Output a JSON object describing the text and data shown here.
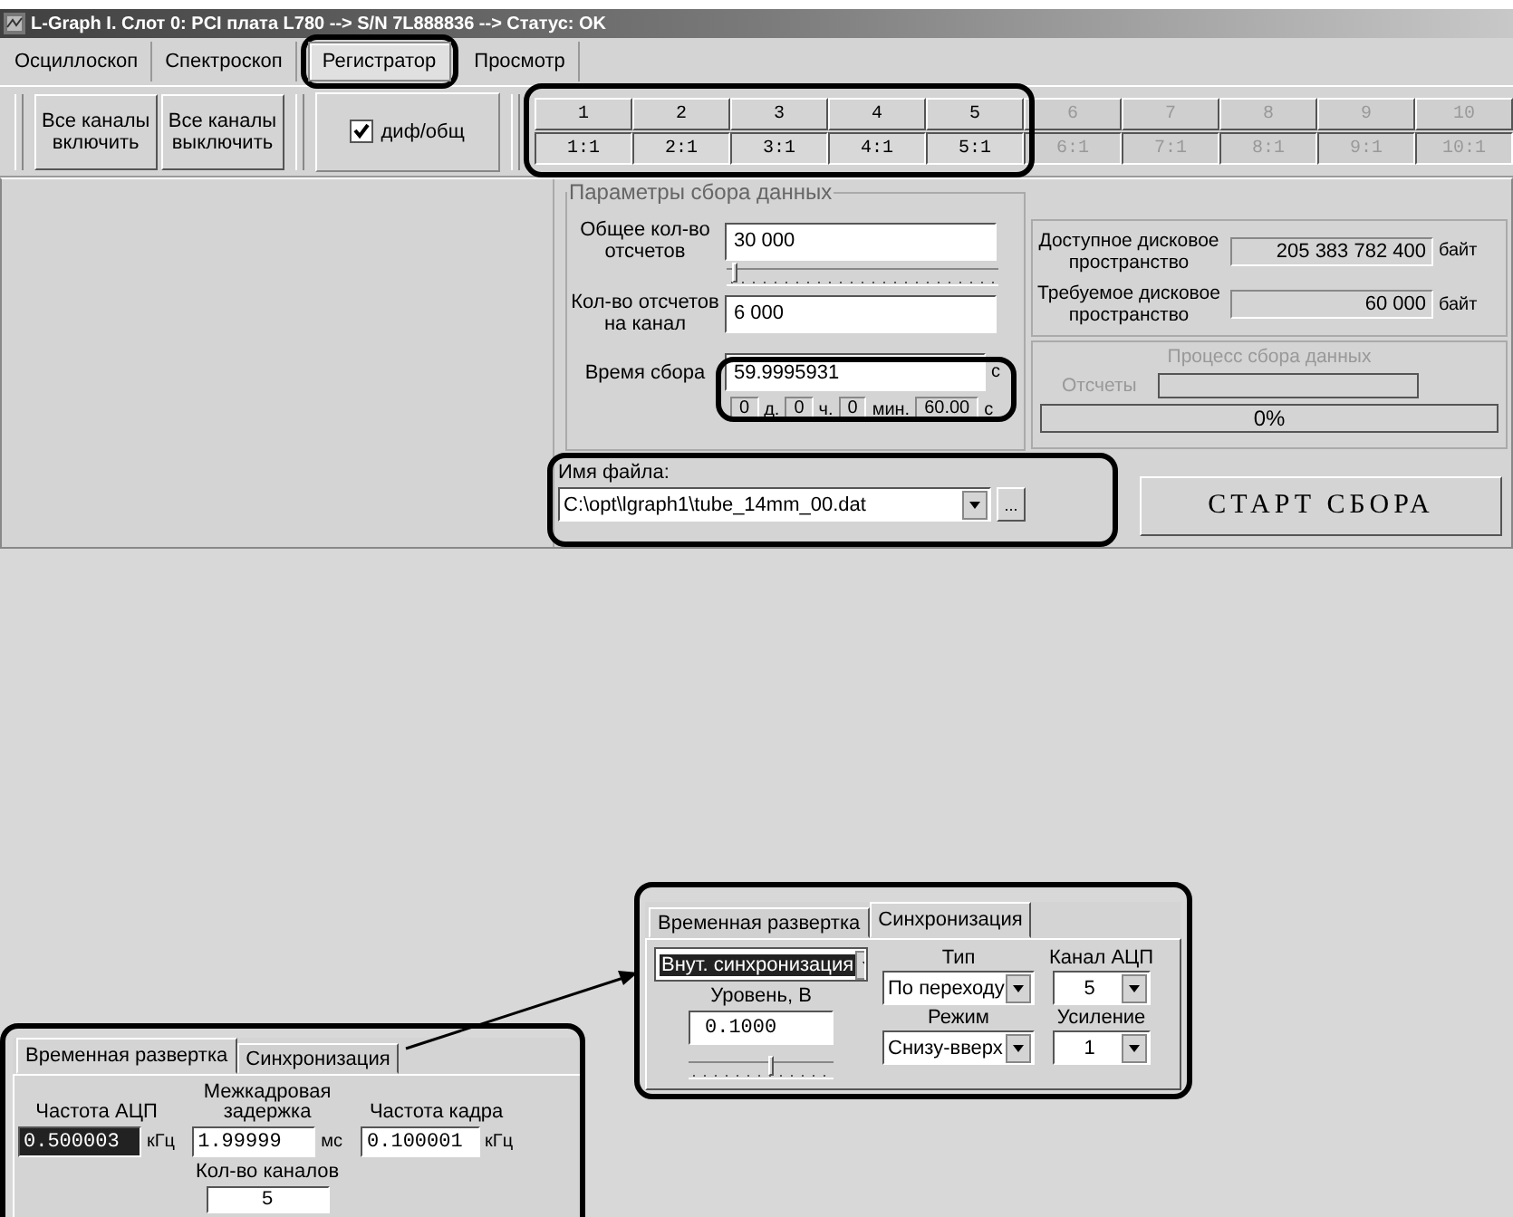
{
  "window": {
    "title": "L-Graph I. Слот 0:  PCI плата L780 --> S/N 7L888836 --> Статус: OK"
  },
  "tabs": [
    {
      "label": "Осциллоскоп",
      "selected": false
    },
    {
      "label": "Спектроскоп",
      "selected": false
    },
    {
      "label": "Регистратор",
      "selected": true
    },
    {
      "label": "Просмотр",
      "selected": false
    }
  ],
  "toolbar": {
    "buttons": [
      "Все каналы включить",
      "Все каналы выключить"
    ],
    "checkbox": {
      "label": "диф/общ",
      "checked": true
    }
  },
  "channels": [
    {
      "number": "1",
      "gain": "1:1",
      "enabled": true
    },
    {
      "number": "2",
      "gain": "2:1",
      "enabled": true
    },
    {
      "number": "3",
      "gain": "3:1",
      "enabled": true
    },
    {
      "number": "4",
      "gain": "4:1",
      "enabled": true
    },
    {
      "number": "5",
      "gain": "5:1",
      "enabled": true
    },
    {
      "number": "6",
      "gain": "6:1",
      "enabled": false
    },
    {
      "number": "7",
      "gain": "7:1",
      "enabled": false
    },
    {
      "number": "8",
      "gain": "8:1",
      "enabled": false
    },
    {
      "number": "9",
      "gain": "9:1",
      "enabled": false
    },
    {
      "number": "10",
      "gain": "10:1",
      "enabled": false
    }
  ],
  "params": {
    "title": "Параметры сбора данных",
    "total_label": "Общее кол-во отсчетов",
    "total_value": "30 000",
    "total_slider": {
      "level": 0.02
    },
    "per_channel_label": "Кол-во отсчетов на канал",
    "per_channel_value": "6 000",
    "time_label": "Время сбора",
    "time_value": "59.9995931",
    "time_unit": "с",
    "duration": [
      {
        "value": "0",
        "unit": "д."
      },
      {
        "value": "0",
        "unit": "ч."
      },
      {
        "value": "0",
        "unit": "мин."
      },
      {
        "value": "60.00",
        "unit": "с"
      }
    ]
  },
  "disk": [
    {
      "label": "Доступное дисковое пространство",
      "value": "205 383 782 400",
      "unit": "байт"
    },
    {
      "label": "Требуемое дисковое пространство",
      "value": "60 000",
      "unit": "байт"
    }
  ],
  "process": {
    "title": "Процесс сбора данных",
    "counts_label": "Отсчеты",
    "percent": "0%",
    "disabled": true
  },
  "file": {
    "label": "Имя файла:",
    "value": "C:\\opt\\lgraph1\\tube_14mm_00.dat",
    "browse": "..."
  },
  "start_button": "СТАРТ СБОРА",
  "timebase_panel": {
    "tabs": [
      {
        "label": "Временная развертка",
        "selected": true
      },
      {
        "label": "Синхронизация",
        "selected": false
      }
    ],
    "adc_rate": {
      "label": "Частота АЦП",
      "value": "0.500003",
      "unit": "кГц",
      "selected": true
    },
    "frame_delay": {
      "label": "Межкадровая задержка",
      "value": "1.99999",
      "unit": "мс",
      "selected": false
    },
    "frame_rate": {
      "label": "Частота кадра",
      "value": "0.100001",
      "unit": "кГц",
      "selected": false
    },
    "channel_count": {
      "label": "Кол-во каналов",
      "value": "5"
    }
  },
  "sync_panel": {
    "tabs": [
      {
        "label": "Временная развертка",
        "selected": false
      },
      {
        "label": "Синхронизация",
        "selected": true
      }
    ],
    "source": {
      "value": "Внут. синхронизация",
      "selected": true
    },
    "level": {
      "label": "Уровень, В",
      "value": "0.1000",
      "slider": {
        "level": 0.55
      }
    },
    "type": {
      "label": "Тип",
      "value": "По переходу"
    },
    "mode": {
      "label": "Режим",
      "value": "Снизу-вверх"
    },
    "adc_channel": {
      "label": "Канал АЦП",
      "value": "5"
    },
    "gain": {
      "label": "Усиление",
      "value": "1"
    }
  }
}
